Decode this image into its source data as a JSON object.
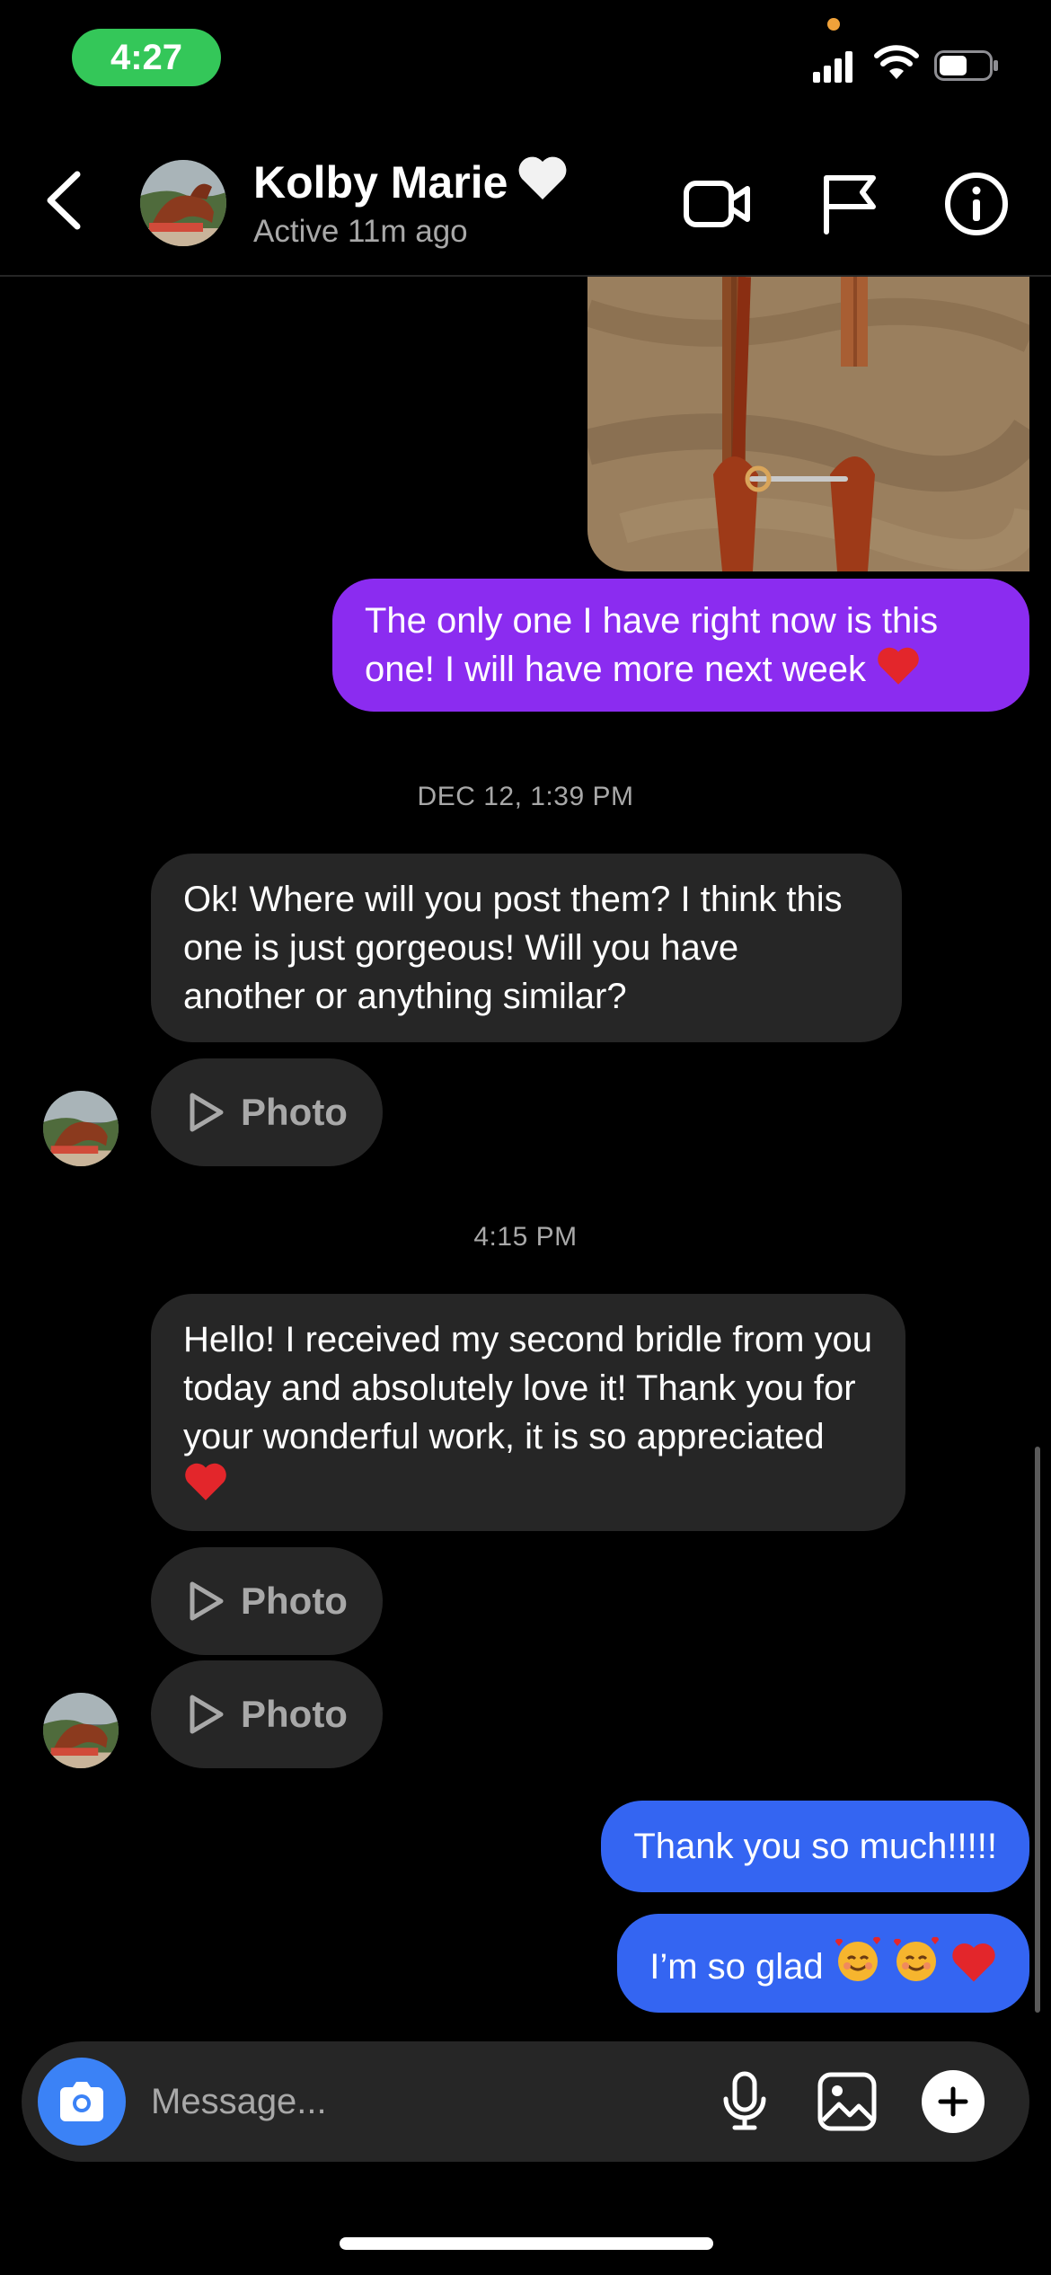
{
  "status_bar": {
    "time": "4:27",
    "icons": [
      "signal-icon",
      "wifi-icon",
      "battery-icon"
    ]
  },
  "header": {
    "contact_name": "Kolby Marie",
    "status": "Active 11m ago",
    "icons": [
      "back-chevron-icon",
      "video-call-icon",
      "flag-icon",
      "info-icon"
    ]
  },
  "messages": {
    "m1": "The only one I have right now is this one! I will have more next week",
    "ts1": "DEC 12, 1:39 PM",
    "m2": "Ok! Where will you post them? I think this one is just gorgeous! Will you have another or anything similar?",
    "photo1": "Photo",
    "ts2": "4:15 PM",
    "m3": "Hello! I received my second bridle from you today and absolutely love it! Thank you for your wonderful work, it is so appreciated",
    "photo2": "Photo",
    "photo3": "Photo",
    "m4": "Thank you so much!!!!!",
    "m5": "I’m so glad"
  },
  "composer": {
    "placeholder": "Message..."
  },
  "colors": {
    "outgoing_purple": "#8b2cf0",
    "outgoing_blue": "#3465f2",
    "incoming_gray": "#262626",
    "active_green": "#34c759"
  }
}
